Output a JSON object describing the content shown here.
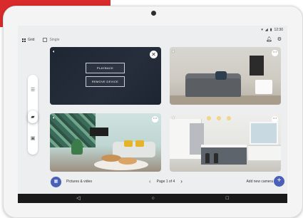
{
  "status_bar": {
    "time": "12:30"
  },
  "view": {
    "grid_label": "Grid",
    "single_label": "Single"
  },
  "tiles": {
    "overlay_playback": "PLAYBACK",
    "overlay_remove": "REMOVE DEVICE"
  },
  "bottom": {
    "pictures_label": "Pictures & video",
    "pager_text": "Page 1 of 4",
    "add_camera_label": "Add new camera"
  },
  "icons": {
    "grid": "grid-icon",
    "single": "single-view-icon",
    "bell": "bell-icon",
    "settings": "gear-icon",
    "close": "close-icon",
    "more": "more-icon",
    "sound": "speaker-icon",
    "add": "plus-icon",
    "back": "android-back-icon",
    "home": "android-home-icon",
    "recents": "android-recents-icon"
  },
  "colors": {
    "accent": "#4a5fb8",
    "red_banner": "#d92b2b"
  }
}
